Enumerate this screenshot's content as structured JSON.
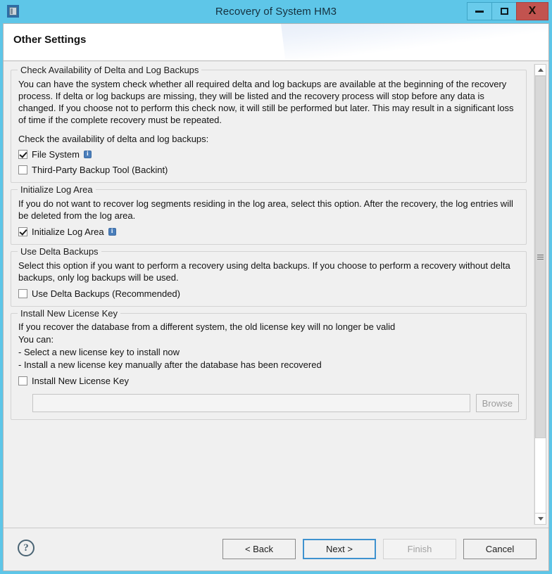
{
  "window": {
    "title": "Recovery of System HM3",
    "icon": "application-window-icon",
    "controls": {
      "minimize": "minimize-icon",
      "maximize": "maximize-icon",
      "close": "X"
    },
    "accent_color": "#5ec6e8",
    "close_color": "#c2534f"
  },
  "header": {
    "title": "Other Settings"
  },
  "groups": [
    {
      "legend": "Check Availability of Delta and Log Backups",
      "paragraph": "You can have the system check whether all required delta and log backups are available at the beginning of the recovery process. If delta or log backups are missing, they will be listed and the recovery process will stop before any data is changed. If you choose not to perform this check now, it will still be performed but later. This may result in a significant loss of time if the complete recovery must be repeated.",
      "sub_label": "Check the availability of delta and log backups:",
      "options": [
        {
          "label": "File System",
          "checked": true,
          "info": true
        },
        {
          "label": "Third-Party Backup Tool (Backint)",
          "checked": false,
          "info": false
        }
      ]
    },
    {
      "legend": "Initialize Log Area",
      "paragraph": "If you do not want to recover log segments residing in the log area, select this option. After the recovery, the log entries will be deleted from the log area.",
      "options": [
        {
          "label": "Initialize Log Area",
          "checked": true,
          "info": true
        }
      ]
    },
    {
      "legend": "Use Delta Backups",
      "paragraph": "Select this option if you want to perform a recovery using delta backups. If you choose to perform a recovery without delta backups, only log backups will be used.",
      "options": [
        {
          "label": "Use Delta Backups (Recommended)",
          "checked": false,
          "info": false
        }
      ]
    },
    {
      "legend": "Install New License Key",
      "lines": [
        "If you recover the database from a different system, the old license key will no longer be valid",
        "You can:",
        "- Select a new license key to install now",
        "- Install a new license key manually after the database has been recovered"
      ],
      "options": [
        {
          "label": "Install New License Key",
          "checked": false,
          "info": false
        }
      ],
      "path_field": {
        "value": "",
        "placeholder": ""
      },
      "browse_label": "Browse"
    }
  ],
  "scrollbar": {
    "up_arrow": "chevron-up-icon",
    "down_arrow": "chevron-down-icon",
    "thumb_grip": "grip-icon"
  },
  "footer": {
    "help": "?",
    "buttons": [
      {
        "label": "< Back",
        "state": "enabled"
      },
      {
        "label": "Next >",
        "state": "default"
      },
      {
        "label": "Finish",
        "state": "disabled"
      },
      {
        "label": "Cancel",
        "state": "enabled"
      }
    ]
  }
}
